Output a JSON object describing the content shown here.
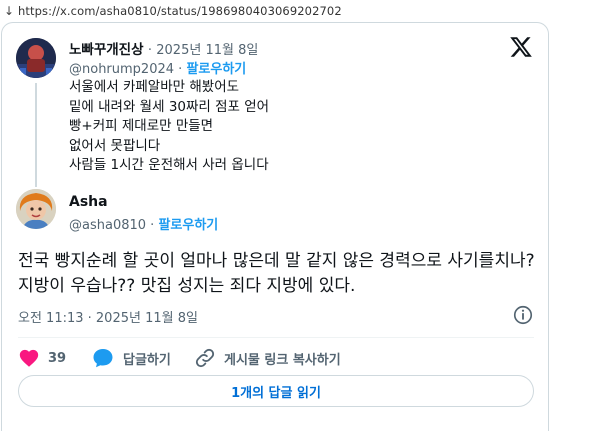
{
  "browser": {
    "nav_arrow": "↓",
    "url": "https://x.com/asha0810/status/1986980403069202702"
  },
  "brand": {
    "logo_icon": "x-logo-icon"
  },
  "quoted_tweet": {
    "display_name": "노빠꾸개진상",
    "separator": "·",
    "date": "2025년 11월 8일",
    "handle": "@nohrump2024",
    "handle_sep": "·",
    "follow_label": "팔로우하기",
    "lines": [
      "서울에서 카페알바만 해봤어도",
      "밑에 내려와 월세 30짜리 점포 얻어",
      "빵+커피 제대로만 만들면",
      "없어서 못팝니다",
      "사람들 1시간 운전해서 사러 옵니다"
    ]
  },
  "tweet": {
    "display_name": "Asha",
    "handle": "@asha0810",
    "handle_sep": "·",
    "follow_label": "팔로우하기",
    "text": "전국 빵지순례 할 곳이 얼마나 많은데 말 같지 않은 경력으로 사기를치나? 지방이 우습나?? 맛집 성지는 죄다 지방에 있다.",
    "timestamp": "오전 11:13 · 2025년 11월 8일"
  },
  "actions": {
    "like_count": "39",
    "reply_label": "답글하기",
    "copy_link_label": "게시물 링크 복사하기"
  },
  "read_replies_label": "1개의 답글 읽기",
  "colors": {
    "accent": "#1d9bf0",
    "like": "#f91880",
    "text": "#0f1419",
    "muted": "#536471",
    "border": "#cfd9de"
  }
}
